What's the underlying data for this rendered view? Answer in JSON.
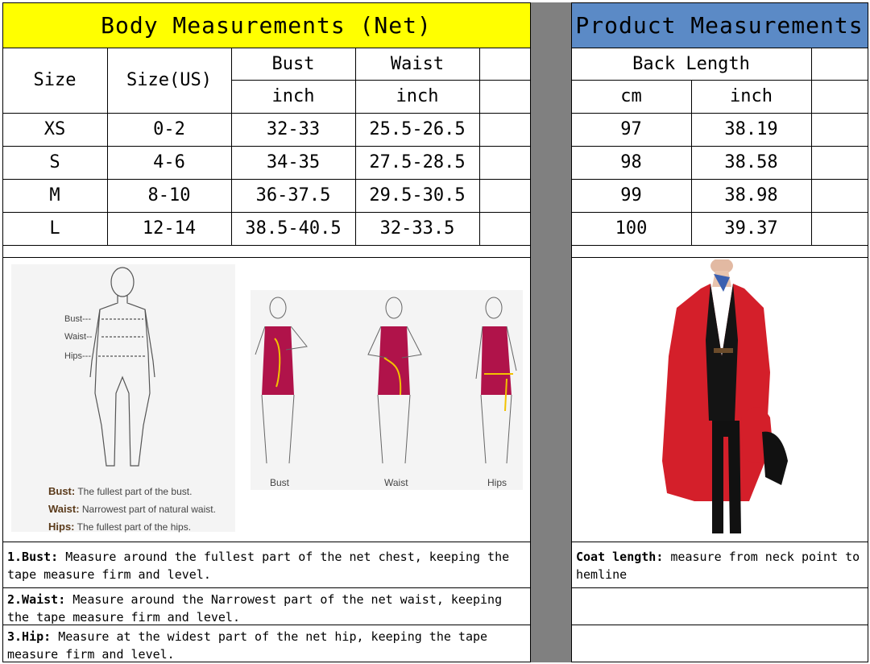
{
  "body_table": {
    "title": "Body Measurements (Net)",
    "header": {
      "size": "Size",
      "size_us": "Size(US)",
      "bust": "Bust",
      "waist": "Waist",
      "bust_unit": "inch",
      "waist_unit": "inch"
    },
    "rows": [
      {
        "size": "XS",
        "us": "0-2",
        "bust": "32-33",
        "waist": "25.5-26.5"
      },
      {
        "size": "S",
        "us": "4-6",
        "bust": "34-35",
        "waist": "27.5-28.5"
      },
      {
        "size": "M",
        "us": "8-10",
        "bust": "36-37.5",
        "waist": "29.5-30.5"
      },
      {
        "size": "L",
        "us": "12-14",
        "bust": "38.5-40.5",
        "waist": "32-33.5"
      }
    ]
  },
  "product_table": {
    "title": "Product Measurements",
    "header": {
      "back_length": "Back Length",
      "cm": "cm",
      "inch": "inch"
    },
    "rows": [
      {
        "cm": "97",
        "inch": "38.19"
      },
      {
        "cm": "98",
        "inch": "38.58"
      },
      {
        "cm": "99",
        "inch": "38.98"
      },
      {
        "cm": "100",
        "inch": "39.37"
      }
    ]
  },
  "figure": {
    "labels": {
      "bust": "Bust---",
      "waist": "Waist--",
      "hips": "Hips---"
    },
    "legend": [
      {
        "term": "Bust:",
        "text": "The fullest part of the bust."
      },
      {
        "term": "Waist:",
        "text": "Narrowest part of natural waist."
      },
      {
        "term": "Hips:",
        "text": "The fullest part of the hips."
      }
    ],
    "captions": [
      "Bust",
      "Waist",
      "Hips"
    ]
  },
  "notes": [
    {
      "term": "1.Bust:",
      "text": " Measure around the fullest part of the net chest, keeping the tape  measure firm and level."
    },
    {
      "term": "2.Waist:",
      "text": " Measure around the Narrowest part of the net waist, keeping the tape  measure firm and level."
    },
    {
      "term": "3.Hip:",
      "text": " Measure at the widest part of the net hip, keeping the tape measure firm and level."
    }
  ],
  "product_note": {
    "term": "Coat length:",
    "text": " measure from neck point to hemline"
  },
  "colors": {
    "title_bg": "#ffff00",
    "product_title_bg": "#5b8ac6",
    "divider": "#808080",
    "coat": "#d41f2a",
    "dress": "#b0134a"
  }
}
